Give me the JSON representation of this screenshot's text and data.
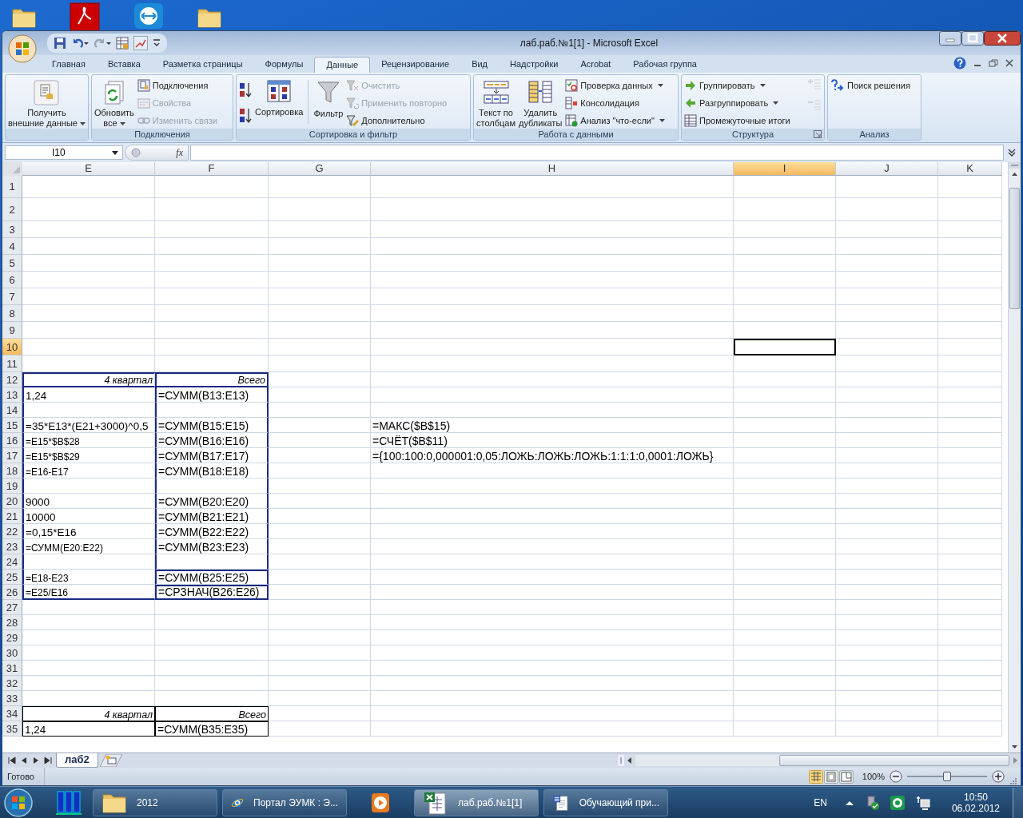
{
  "window": {
    "title": "лаб.раб.№1[1] - Microsoft Excel"
  },
  "ribbon": {
    "tabs": [
      {
        "label": "Главная",
        "selected": false
      },
      {
        "label": "Вставка",
        "selected": false
      },
      {
        "label": "Разметка страницы",
        "selected": false
      },
      {
        "label": "Формулы",
        "selected": false
      },
      {
        "label": "Данные",
        "selected": true
      },
      {
        "label": "Рецензирование",
        "selected": false
      },
      {
        "label": "Вид",
        "selected": false
      },
      {
        "label": "Надстройки",
        "selected": false
      },
      {
        "label": "Acrobat",
        "selected": false
      },
      {
        "label": "Рабочая группа",
        "selected": false
      }
    ],
    "groups": [
      {
        "items": [
          {
            "kind": "large",
            "label": "Получить\nвнешние данные",
            "dropdown": true,
            "disabled": false
          }
        ]
      },
      {
        "label": "Подключения",
        "items": [
          {
            "kind": "large",
            "label": "Обновить\nвсе",
            "dropdown": true,
            "disabled": false
          },
          {
            "kind": "small",
            "label": "Подключения",
            "dropdown": false,
            "disabled": false
          },
          {
            "kind": "small",
            "label": "Свойства",
            "dropdown": false,
            "disabled": true
          },
          {
            "kind": "small",
            "label": "Изменить связи",
            "dropdown": false,
            "disabled": true
          }
        ]
      },
      {
        "label": "Сортировка и фильтр",
        "items": [
          {
            "kind": "icon",
            "disabled": false
          },
          {
            "kind": "icon",
            "disabled": false
          },
          {
            "kind": "large",
            "label": "Сортировка",
            "dropdown": false,
            "disabled": false
          },
          {
            "kind": "large",
            "label": "Фильтр",
            "dropdown": false,
            "disabled": false
          },
          {
            "kind": "small",
            "label": "Очистить",
            "dropdown": false,
            "disabled": true
          },
          {
            "kind": "small",
            "label": "Применить повторно",
            "dropdown": false,
            "disabled": true
          },
          {
            "kind": "small",
            "label": "Дополнительно",
            "dropdown": false,
            "disabled": false
          }
        ]
      },
      {
        "label": "Работа с данными",
        "items": [
          {
            "kind": "large",
            "label": "Текст по\nстолбцам",
            "dropdown": false,
            "disabled": false
          },
          {
            "kind": "large",
            "label": "Удалить\nдубликаты",
            "dropdown": false,
            "disabled": false
          },
          {
            "kind": "small",
            "label": "Проверка данных",
            "dropdown": true,
            "disabled": false
          },
          {
            "kind": "small",
            "label": "Консолидация",
            "dropdown": false,
            "disabled": false
          },
          {
            "kind": "small",
            "label": "Анализ \"что-если\"",
            "dropdown": true,
            "disabled": false
          }
        ]
      },
      {
        "label": "Структура",
        "launcher": true,
        "items": [
          {
            "kind": "small",
            "label": "Группировать",
            "dropdown": true,
            "disabled": false
          },
          {
            "kind": "small",
            "label": "Разгруппировать",
            "dropdown": true,
            "disabled": false
          },
          {
            "kind": "small",
            "label": "Промежуточные итоги",
            "dropdown": false,
            "disabled": false
          }
        ]
      },
      {
        "label": "Анализ",
        "items": [
          {
            "kind": "small",
            "label": "Поиск решения",
            "dropdown": false,
            "disabled": false
          }
        ]
      }
    ]
  },
  "formula_bar": {
    "name_box": "I10",
    "fx": "fx"
  },
  "sheet": {
    "columns": [
      {
        "label": "E",
        "selected": false
      },
      {
        "label": "F",
        "selected": false
      },
      {
        "label": "G",
        "selected": false
      },
      {
        "label": "H",
        "selected": false
      },
      {
        "label": "I",
        "selected": true
      },
      {
        "label": "J",
        "selected": false
      },
      {
        "label": "K",
        "selected": false
      }
    ],
    "rows": [
      {
        "number": "1",
        "selected": false
      },
      {
        "number": "2",
        "selected": false
      },
      {
        "number": "3",
        "selected": false
      },
      {
        "number": "4",
        "selected": false
      },
      {
        "number": "5",
        "selected": false
      },
      {
        "number": "6",
        "selected": false
      },
      {
        "number": "7",
        "selected": false
      },
      {
        "number": "8",
        "selected": false
      },
      {
        "number": "9",
        "selected": false
      },
      {
        "number": "10",
        "selected": true,
        "cells": {
          "I": {
            "selected": true
          }
        }
      },
      {
        "number": "11",
        "selected": false
      },
      {
        "number": "12",
        "selected": false,
        "cells": {
          "E": {
            "text": "4 квартал",
            "kind": "italic",
            "top": true,
            "left": true,
            "bottom": true,
            "thick": true
          },
          "F": {
            "text": "Всего",
            "kind": "italic",
            "top": true,
            "left": true,
            "right": true,
            "bottom": true,
            "thick": true
          }
        }
      },
      {
        "number": "13",
        "selected": false,
        "cells": {
          "E": {
            "text": "1,24",
            "kind": "normal",
            "left": true,
            "thick": true
          },
          "F": {
            "text": "=СУММ(B13:E13)",
            "kind": "normal",
            "left": true,
            "right": true,
            "thick": true
          }
        }
      },
      {
        "number": "14",
        "selected": false,
        "cells": {
          "E": {
            "left": true,
            "thick": true
          },
          "F": {
            "left": true,
            "right": true,
            "thick": true
          }
        }
      },
      {
        "number": "15",
        "selected": false,
        "cells": {
          "E": {
            "text": "=35*E13*(E21+3000)^0,5",
            "kind": "normal",
            "left": true,
            "thick": true
          },
          "F": {
            "text": "=СУММ(B15:E15)",
            "kind": "normal",
            "left": true,
            "right": true,
            "thick": true
          },
          "H": {
            "text": "=МАКС($B$15)",
            "kind": "normal"
          }
        }
      },
      {
        "number": "16",
        "selected": false,
        "cells": {
          "E": {
            "text": "=E15*$B$28",
            "kind": "small",
            "left": true,
            "thick": true
          },
          "F": {
            "text": "=СУММ(B16:E16)",
            "kind": "normal",
            "left": true,
            "right": true,
            "thick": true
          },
          "H": {
            "text": "=СЧЁТ($B$11)",
            "kind": "normal"
          }
        }
      },
      {
        "number": "17",
        "selected": false,
        "cells": {
          "E": {
            "text": "=E15*$B$29",
            "kind": "small",
            "left": true,
            "thick": true
          },
          "F": {
            "text": "=СУММ(B17:E17)",
            "kind": "normal",
            "left": true,
            "right": true,
            "thick": true
          },
          "H": {
            "text": "={100:100:0,000001:0,05:ЛОЖЬ:ЛОЖЬ:ЛОЖЬ:1:1:1:0,0001:ЛОЖЬ}",
            "kind": "normal"
          }
        }
      },
      {
        "number": "18",
        "selected": false,
        "cells": {
          "E": {
            "text": "=E16-E17",
            "kind": "small",
            "left": true,
            "thick": true
          },
          "F": {
            "text": "=СУММ(B18:E18)",
            "kind": "normal",
            "left": true,
            "right": true,
            "thick": true
          }
        }
      },
      {
        "number": "19",
        "selected": false,
        "cells": {
          "E": {
            "left": true,
            "thick": true
          },
          "F": {
            "left": true,
            "right": true,
            "thick": true
          }
        }
      },
      {
        "number": "20",
        "selected": false,
        "cells": {
          "E": {
            "text": "9000",
            "kind": "normal",
            "left": true,
            "thick": true
          },
          "F": {
            "text": "=СУММ(B20:E20)",
            "kind": "normal",
            "left": true,
            "right": true,
            "thick": true
          }
        }
      },
      {
        "number": "21",
        "selected": false,
        "cells": {
          "E": {
            "text": "10000",
            "kind": "normal",
            "left": true,
            "thick": true
          },
          "F": {
            "text": "=СУММ(B21:E21)",
            "kind": "normal",
            "left": true,
            "right": true,
            "thick": true
          }
        }
      },
      {
        "number": "22",
        "selected": false,
        "cells": {
          "E": {
            "text": "=0,15*E16",
            "kind": "normal",
            "left": true,
            "thick": true
          },
          "F": {
            "text": "=СУММ(B22:E22)",
            "kind": "normal",
            "left": true,
            "right": true,
            "thick": true
          }
        }
      },
      {
        "number": "23",
        "selected": false,
        "cells": {
          "E": {
            "text": "=СУММ(E20:E22)",
            "kind": "small",
            "left": true,
            "thick": true
          },
          "F": {
            "text": "=СУММ(B23:E23)",
            "kind": "normal",
            "left": true,
            "right": true,
            "thick": true
          }
        }
      },
      {
        "number": "24",
        "selected": false,
        "cells": {
          "E": {
            "left": true,
            "thick": true
          },
          "F": {
            "left": true,
            "right": true,
            "thick": true
          }
        }
      },
      {
        "number": "25",
        "selected": false,
        "cells": {
          "E": {
            "text": "=E18-E23",
            "kind": "small",
            "left": true,
            "thick": true
          },
          "F": {
            "text": "=СУММ(B25:E25)",
            "kind": "normal",
            "top": true,
            "left": true,
            "right": true,
            "thick": true
          }
        }
      },
      {
        "number": "26",
        "selected": false,
        "cells": {
          "E": {
            "text": "=E25/E16",
            "kind": "small",
            "left": true,
            "bottom": true,
            "thick": true
          },
          "F": {
            "text": "=СРЗНАЧ(B26:E26)",
            "kind": "normal",
            "top": true,
            "left": true,
            "right": true,
            "bottom": true,
            "thick": true
          }
        }
      },
      {
        "number": "27",
        "selected": false
      },
      {
        "number": "28",
        "selected": false
      },
      {
        "number": "29",
        "selected": false
      },
      {
        "number": "30",
        "selected": false
      },
      {
        "number": "31",
        "selected": false
      },
      {
        "number": "32",
        "selected": false
      },
      {
        "number": "33",
        "selected": false
      },
      {
        "number": "34",
        "selected": false,
        "cells": {
          "E": {
            "text": "4 квартал",
            "kind": "italic",
            "top": true,
            "left": true,
            "right": true,
            "bottom": true,
            "thick": false
          },
          "F": {
            "text": "Всего",
            "kind": "italic",
            "top": true,
            "left": true,
            "right": true,
            "bottom": true,
            "thick": false
          }
        }
      },
      {
        "number": "35",
        "selected": false,
        "cells": {
          "E": {
            "text": "1,24",
            "kind": "normal",
            "top": true,
            "left": true,
            "right": true,
            "bottom": true,
            "thick": false
          },
          "F": {
            "text": "=СУММ(B35:E35)",
            "kind": "normal",
            "top": true,
            "left": true,
            "right": true,
            "bottom": true,
            "thick": false
          }
        }
      }
    ]
  },
  "sheet_tabs": [
    {
      "label": "лаб2",
      "selected": true
    }
  ],
  "status_bar": {
    "status": "Готово",
    "views": [
      {
        "selected": true
      },
      {
        "selected": false
      },
      {
        "selected": false
      }
    ],
    "zoom": "100%",
    "zoom_level": {
      "level": 0.5
    }
  },
  "taskbar": {
    "buttons": [
      {
        "kind": "folder",
        "label": "2012",
        "selected": false
      },
      {
        "kind": "browser",
        "label": "Портал ЭУМК : Э...",
        "selected": false
      },
      {
        "kind": "player",
        "selected": false
      },
      {
        "kind": "excel",
        "label": "лаб.раб.№1[1]",
        "selected": true
      },
      {
        "kind": "word",
        "label": "Обучающий при...",
        "selected": false
      }
    ],
    "language": "EN",
    "time": "10:50",
    "date": "06.02.2012"
  }
}
